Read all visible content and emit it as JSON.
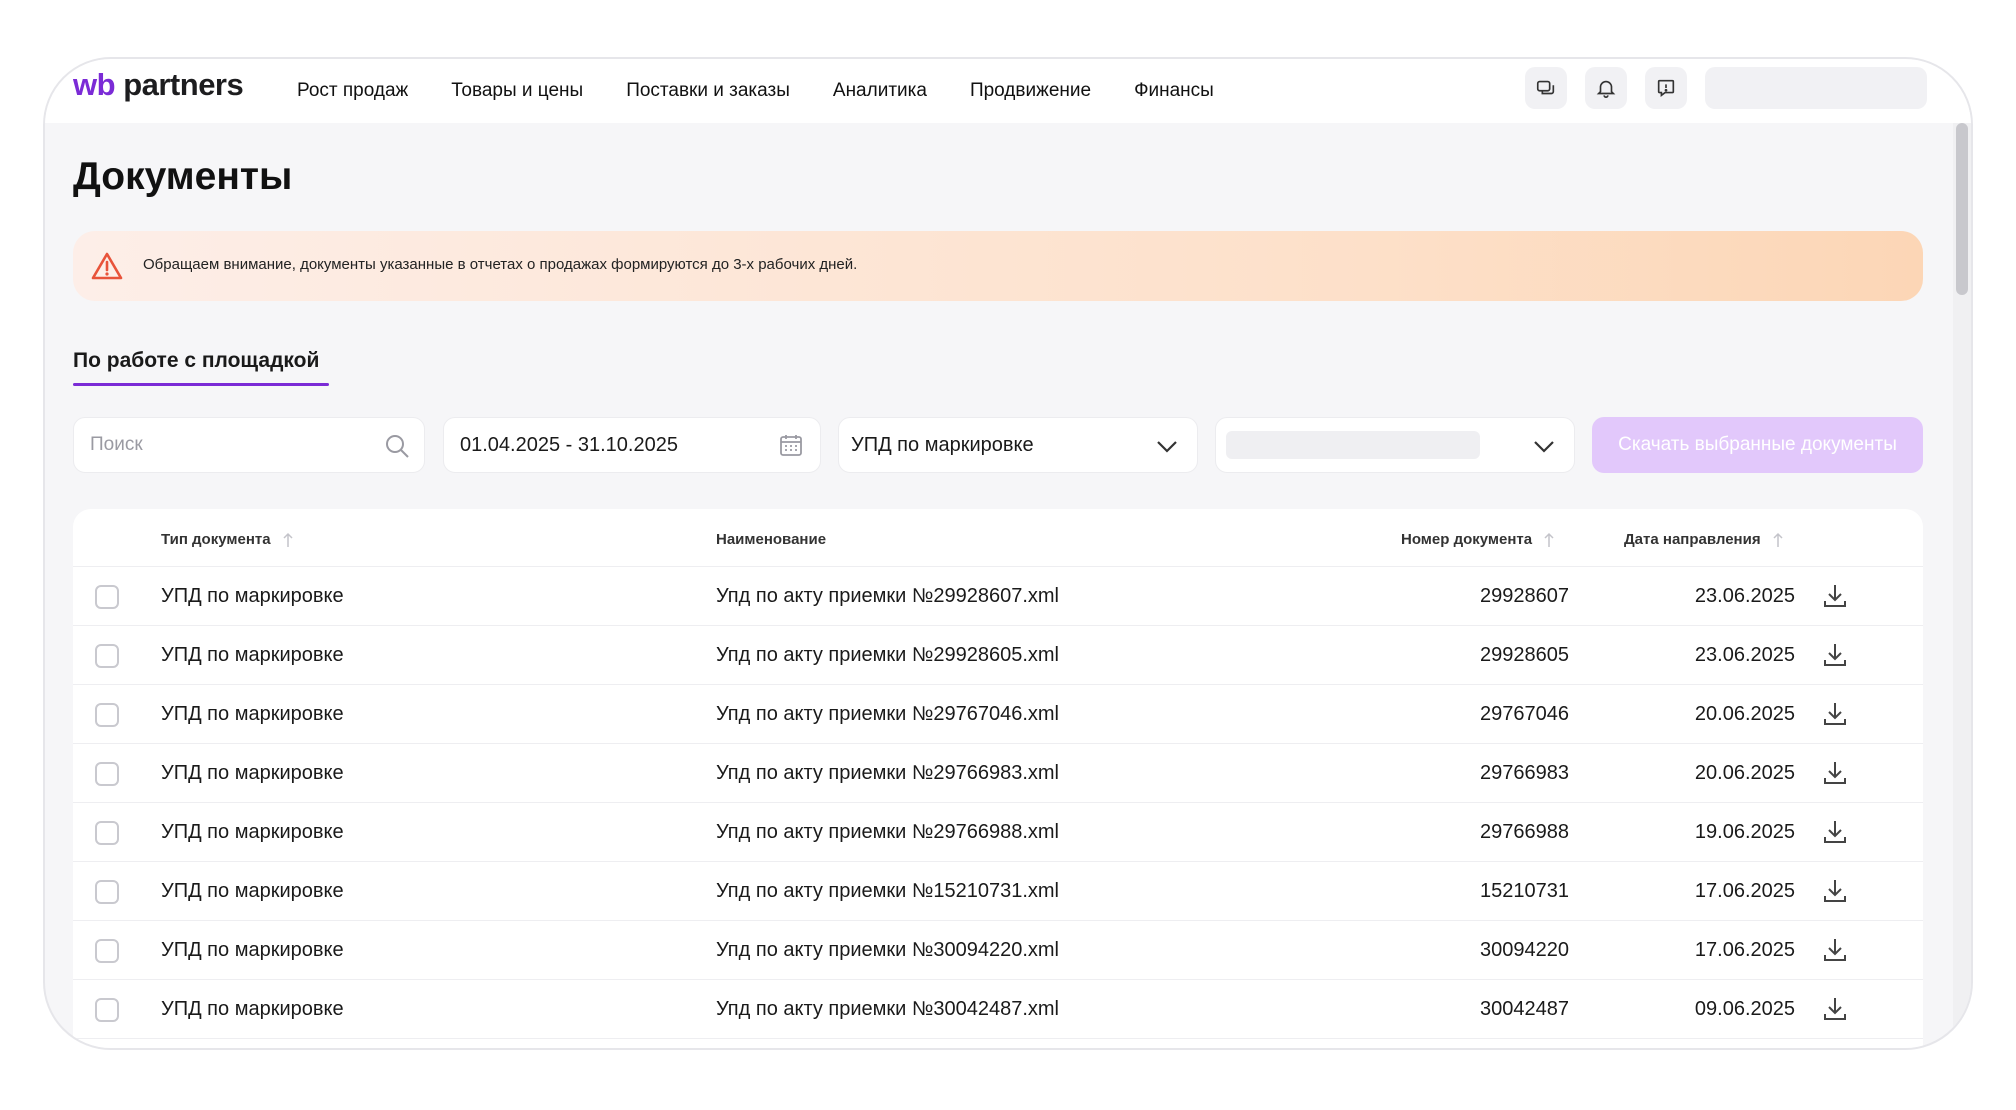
{
  "logo": {
    "wb": "wb",
    "partners": "partners"
  },
  "nav": [
    "Рост продаж",
    "Товары и цены",
    "Поставки и заказы",
    "Аналитика",
    "Продвижение",
    "Финансы"
  ],
  "icons": {
    "chat": "chat-icon",
    "bell": "bell-icon",
    "support": "support-icon",
    "warning": "warning-icon",
    "search": "search-icon",
    "calendar": "calendar-icon",
    "chevron": "chevron-down-icon",
    "download": "download-icon",
    "sort": "sort-arrow-icon"
  },
  "colors": {
    "accent": "#7b2bd6",
    "button_disabled": "#e2c8fb",
    "warning": "#e8533a"
  },
  "page_title": "Документы",
  "notice": "Обращаем внимание, документы указанные в отчетах о продажах формируются до 3-х рабочих дней.",
  "tab": "По работе с площадкой",
  "filters": {
    "search_placeholder": "Поиск",
    "date_range": "01.04.2025 - 31.10.2025",
    "doc_type": "УПД по маркировке",
    "download_selected": "Скачать выбранные документы"
  },
  "table": {
    "headers": {
      "type": "Тип документа",
      "name": "Наименование",
      "number": "Номер документа",
      "date": "Дата направления"
    },
    "rows": [
      {
        "type": "УПД по маркировке",
        "name": "Упд по акту приемки №29928607.xml",
        "number": "29928607",
        "date": "23.06.2025"
      },
      {
        "type": "УПД по маркировке",
        "name": "Упд по акту приемки №29928605.xml",
        "number": "29928605",
        "date": "23.06.2025"
      },
      {
        "type": "УПД по маркировке",
        "name": "Упд по акту приемки №29767046.xml",
        "number": "29767046",
        "date": "20.06.2025"
      },
      {
        "type": "УПД по маркировке",
        "name": "Упд по акту приемки №29766983.xml",
        "number": "29766983",
        "date": "20.06.2025"
      },
      {
        "type": "УПД по маркировке",
        "name": "Упд по акту приемки №29766988.xml",
        "number": "29766988",
        "date": "19.06.2025"
      },
      {
        "type": "УПД по маркировке",
        "name": "Упд по акту приемки №15210731.xml",
        "number": "15210731",
        "date": "17.06.2025"
      },
      {
        "type": "УПД по маркировке",
        "name": "Упд по акту приемки №30094220.xml",
        "number": "30094220",
        "date": "17.06.2025"
      },
      {
        "type": "УПД по маркировке",
        "name": "Упд по акту приемки №30042487.xml",
        "number": "30042487",
        "date": "09.06.2025"
      }
    ]
  }
}
